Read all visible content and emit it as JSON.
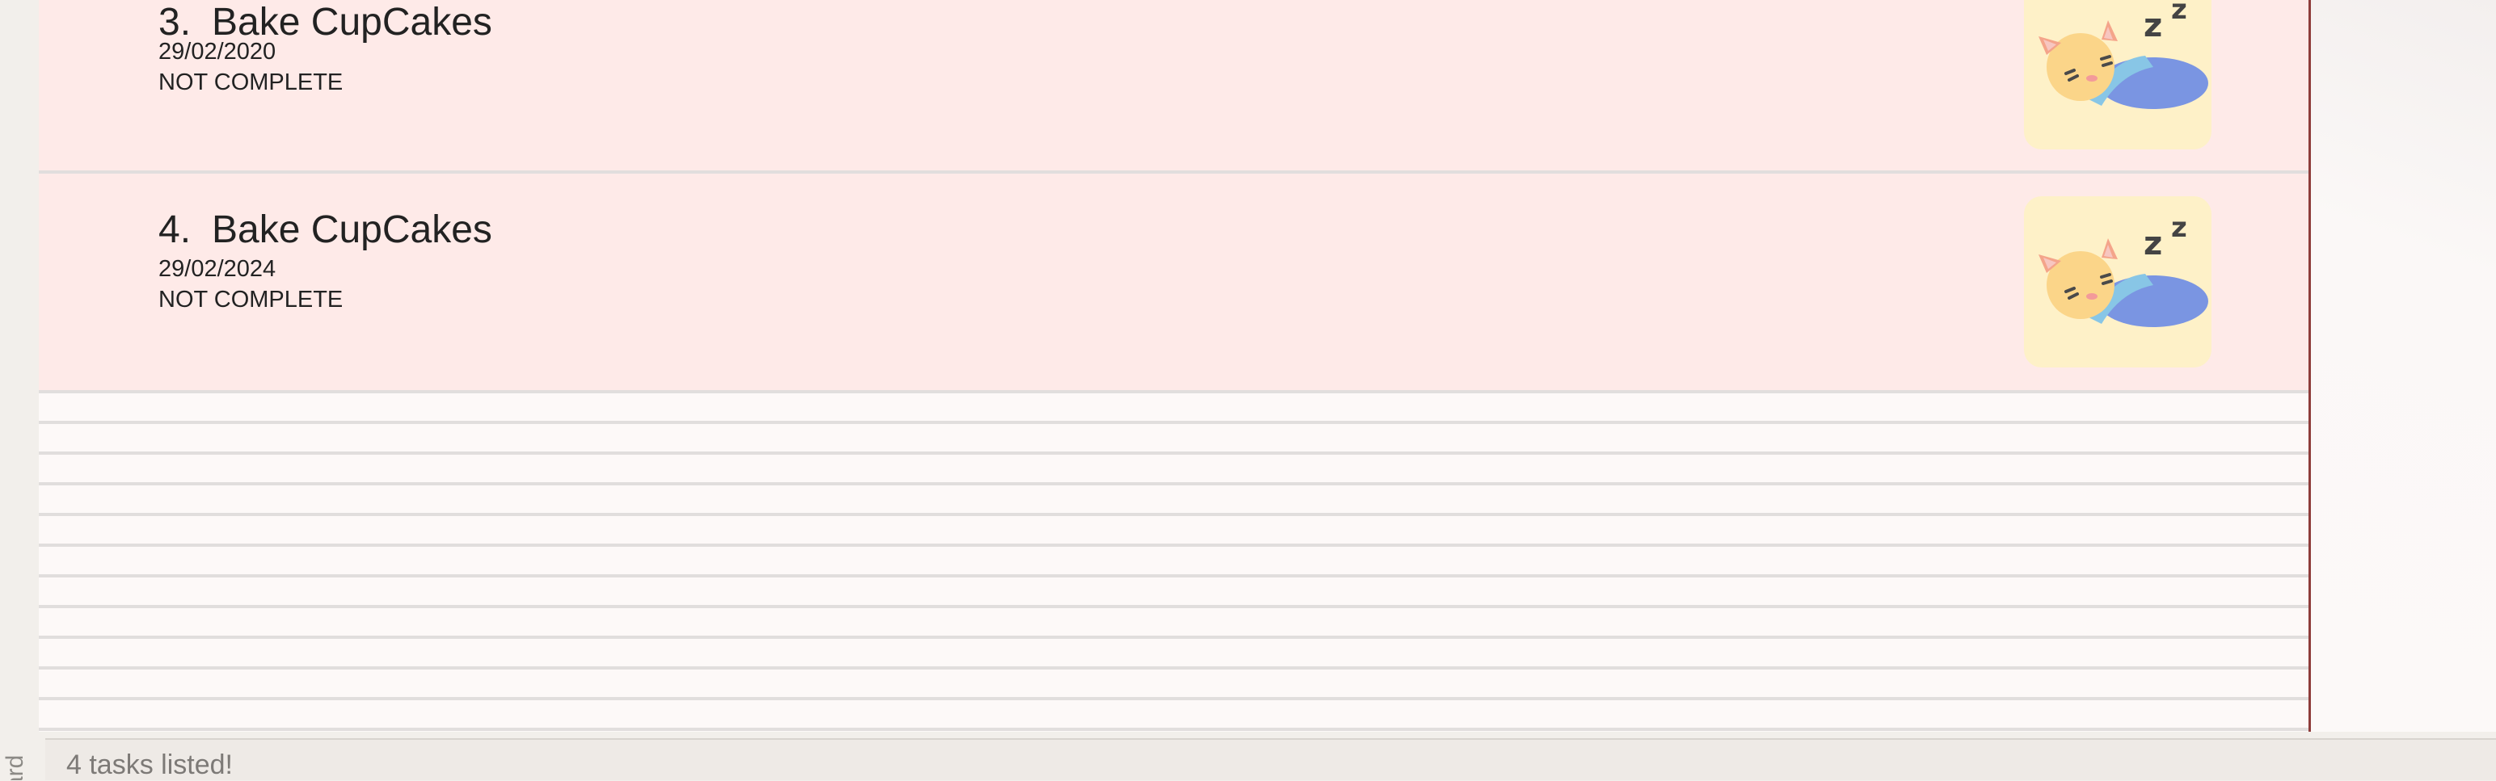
{
  "sidebar": {
    "label": "ard"
  },
  "tasks": [
    {
      "index": "3.",
      "title": "Bake CupCakes",
      "date": "29/02/2020",
      "status": "NOT COMPLETE",
      "icon": "sleeping-cat-icon"
    },
    {
      "index": "4.",
      "title": "Bake CupCakes",
      "date": "29/02/2024",
      "status": "NOT COMPLETE",
      "icon": "sleeping-cat-icon"
    }
  ],
  "status_bar": {
    "message": "4 tasks listed!"
  },
  "colors": {
    "card_background": "#feeae8",
    "badge_background": "#fef1c8",
    "panel_border": "#8e3c3a",
    "status_text": "#7d7a77"
  }
}
